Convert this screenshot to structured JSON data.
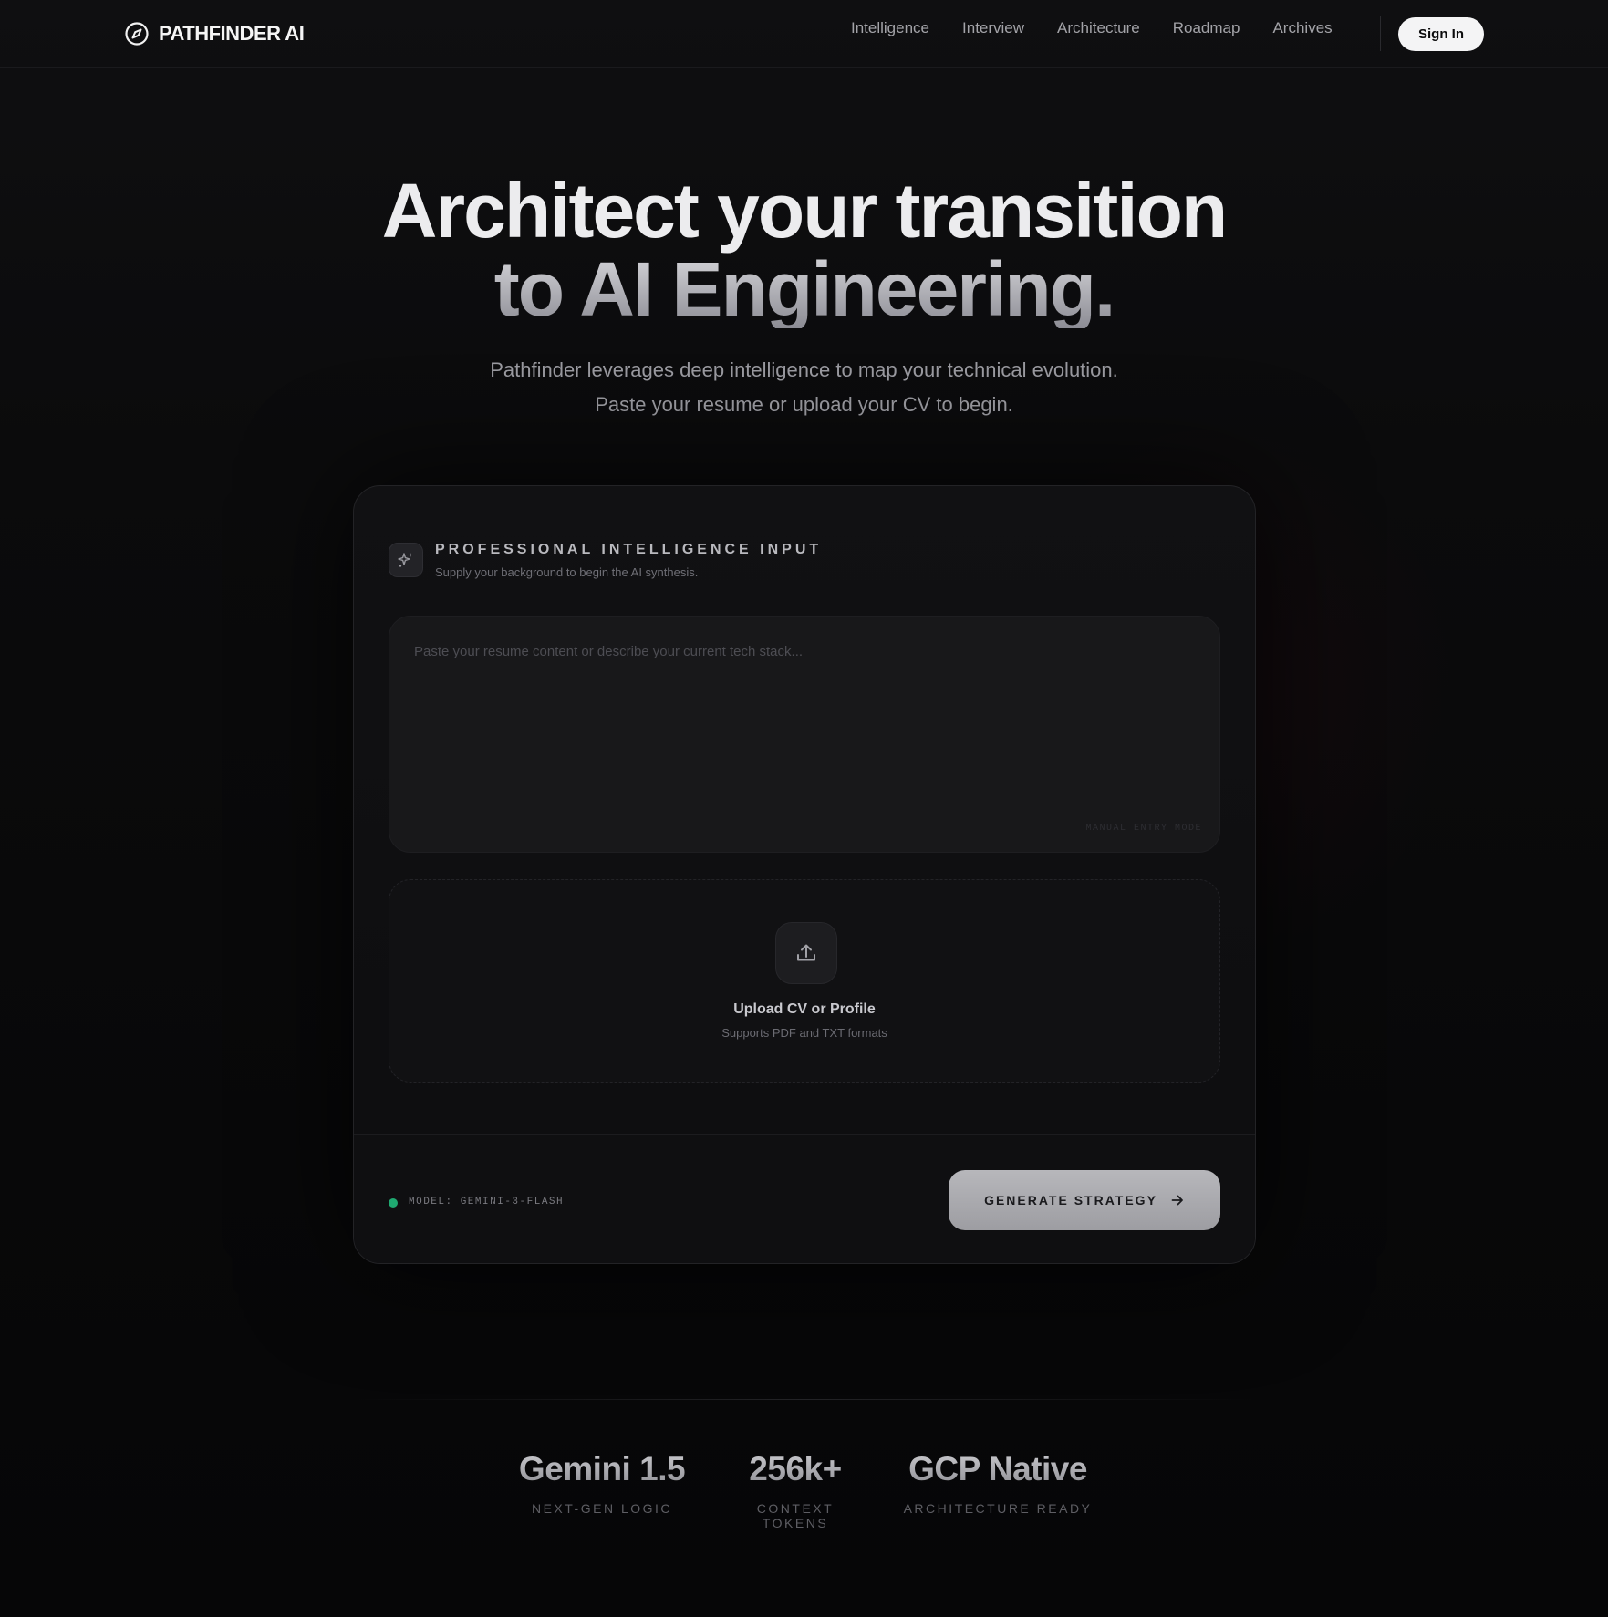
{
  "nav": {
    "brand": "PATHFINDER AI",
    "links": [
      "Intelligence",
      "Interview",
      "Architecture",
      "Roadmap",
      "Archives"
    ],
    "signin_label": "Sign In"
  },
  "hero": {
    "title_line1": "Architect your transition",
    "title_line2": "to AI Engineering.",
    "subtitle_line1": "Pathfinder leverages deep intelligence to map your technical evolution.",
    "subtitle_line2": "Paste your resume or upload your CV to begin."
  },
  "card": {
    "title": "PROFESSIONAL INTELLIGENCE INPUT",
    "description": "Supply your background to begin the AI synthesis.",
    "textarea_placeholder": "Paste your resume content or describe your current tech stack...",
    "textarea_value": "",
    "mode_tag": "MANUAL ENTRY MODE",
    "upload_title": "Upload CV or Profile",
    "upload_subtitle": "Supports PDF and TXT formats",
    "model_label": "MODEL: GEMINI-3-FLASH",
    "generate_label": "GENERATE STRATEGY"
  },
  "stats": [
    {
      "value": "Gemini 1.5",
      "label": "NEXT-GEN LOGIC"
    },
    {
      "value": "256k+",
      "label": "CONTEXT TOKENS"
    },
    {
      "value": "GCP Native",
      "label": "ARCHITECTURE READY"
    }
  ],
  "colors": {
    "background": "#0b0b0c",
    "status_dot": "#1fa971",
    "signin_bg": "#f4f4f5",
    "generate_bg": "#b7b7bb"
  },
  "icons": {
    "brand": "compass-icon",
    "card_header": "sparkles-icon",
    "upload": "upload-icon",
    "generate": "arrow-right-icon"
  }
}
